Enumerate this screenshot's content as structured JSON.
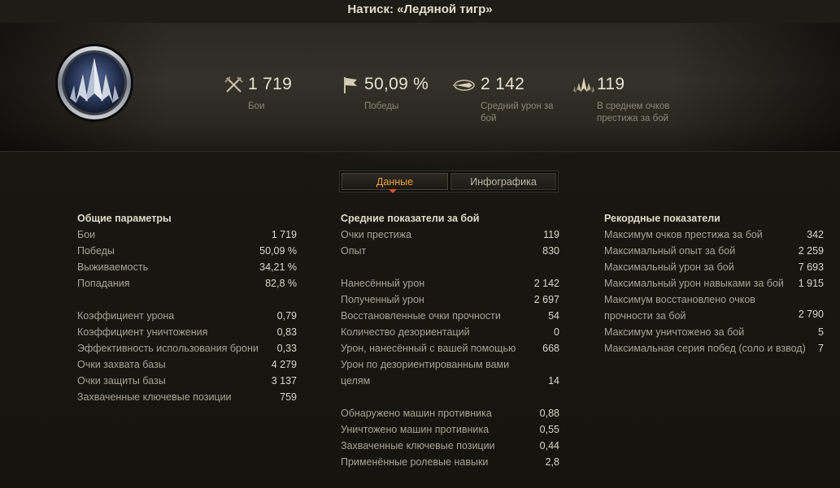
{
  "title": "Натиск: «Ледяной тигр»",
  "summary": [
    {
      "icon": "crossed-swords-icon",
      "value": "1 719",
      "label": "Бои"
    },
    {
      "icon": "flag-icon",
      "value": "50,09 %",
      "label": "Победы"
    },
    {
      "icon": "damage-shell-icon",
      "value": "2 142",
      "label": "Средний урон за бой"
    },
    {
      "icon": "prestige-icon",
      "value": "119",
      "label": "В среднем очков престижа за бой"
    }
  ],
  "tabs": {
    "active": "Данные",
    "inactive": "Инфографика"
  },
  "columns": {
    "general": {
      "title": "Общие параметры",
      "rows": [
        {
          "k": "Бои",
          "v": "1 719"
        },
        {
          "k": "Победы",
          "v": "50,09 %"
        },
        {
          "k": "Выживаемость",
          "v": "34,21 %"
        },
        {
          "k": "Попадания",
          "v": "82,8 %"
        },
        {
          "k": "Коэффициент урона",
          "v": "0,79"
        },
        {
          "k": "Коэффициент уничтожения",
          "v": "0,83"
        },
        {
          "k": "Эффективность использования брони",
          "v": "0,33"
        },
        {
          "k": "Очки захвата базы",
          "v": "4 279"
        },
        {
          "k": "Очки защиты базы",
          "v": "3 137"
        },
        {
          "k": "Захваченные ключевые позиции",
          "v": "759"
        }
      ]
    },
    "average": {
      "title": "Средние показатели за бой",
      "rows": [
        {
          "k": "Очки престижа",
          "v": "119"
        },
        {
          "k": "Опыт",
          "v": "830"
        },
        {
          "k": "Нанесённый урон",
          "v": "2 142"
        },
        {
          "k": "Полученный урон",
          "v": "2 697"
        },
        {
          "k": "Восстановленные очки прочности",
          "v": "54"
        },
        {
          "k": "Количество дезориентаций",
          "v": "0"
        },
        {
          "k": "Урон, нанесённый с вашей помощью",
          "v": "668"
        },
        {
          "k": "Урон по дезориентированным вами целям",
          "v": "14"
        },
        {
          "k": "Обнаружено машин противника",
          "v": "0,88"
        },
        {
          "k": "Уничтожено машин противника",
          "v": "0,55"
        },
        {
          "k": "Захваченные ключевые позиции",
          "v": "0,44"
        },
        {
          "k": "Применённые ролевые навыки",
          "v": "2,8"
        }
      ]
    },
    "records": {
      "title": "Рекордные показатели",
      "rows": [
        {
          "k": "Максимум очков престижа за бой",
          "v": "342"
        },
        {
          "k": "Максимальный опыт за бой",
          "v": "2 259"
        },
        {
          "k": "Максимальный урон за бой",
          "v": "7 693"
        },
        {
          "k": "Максимальный урон навыками за бой",
          "v": "1 915"
        },
        {
          "k": "Максимум восстановлено очков прочности за бой",
          "v": "2 790"
        },
        {
          "k": "Максимум уничтожено за бой",
          "v": "5"
        },
        {
          "k": "Максимальная серия побед (соло и взвод)",
          "v": "7"
        }
      ]
    }
  }
}
